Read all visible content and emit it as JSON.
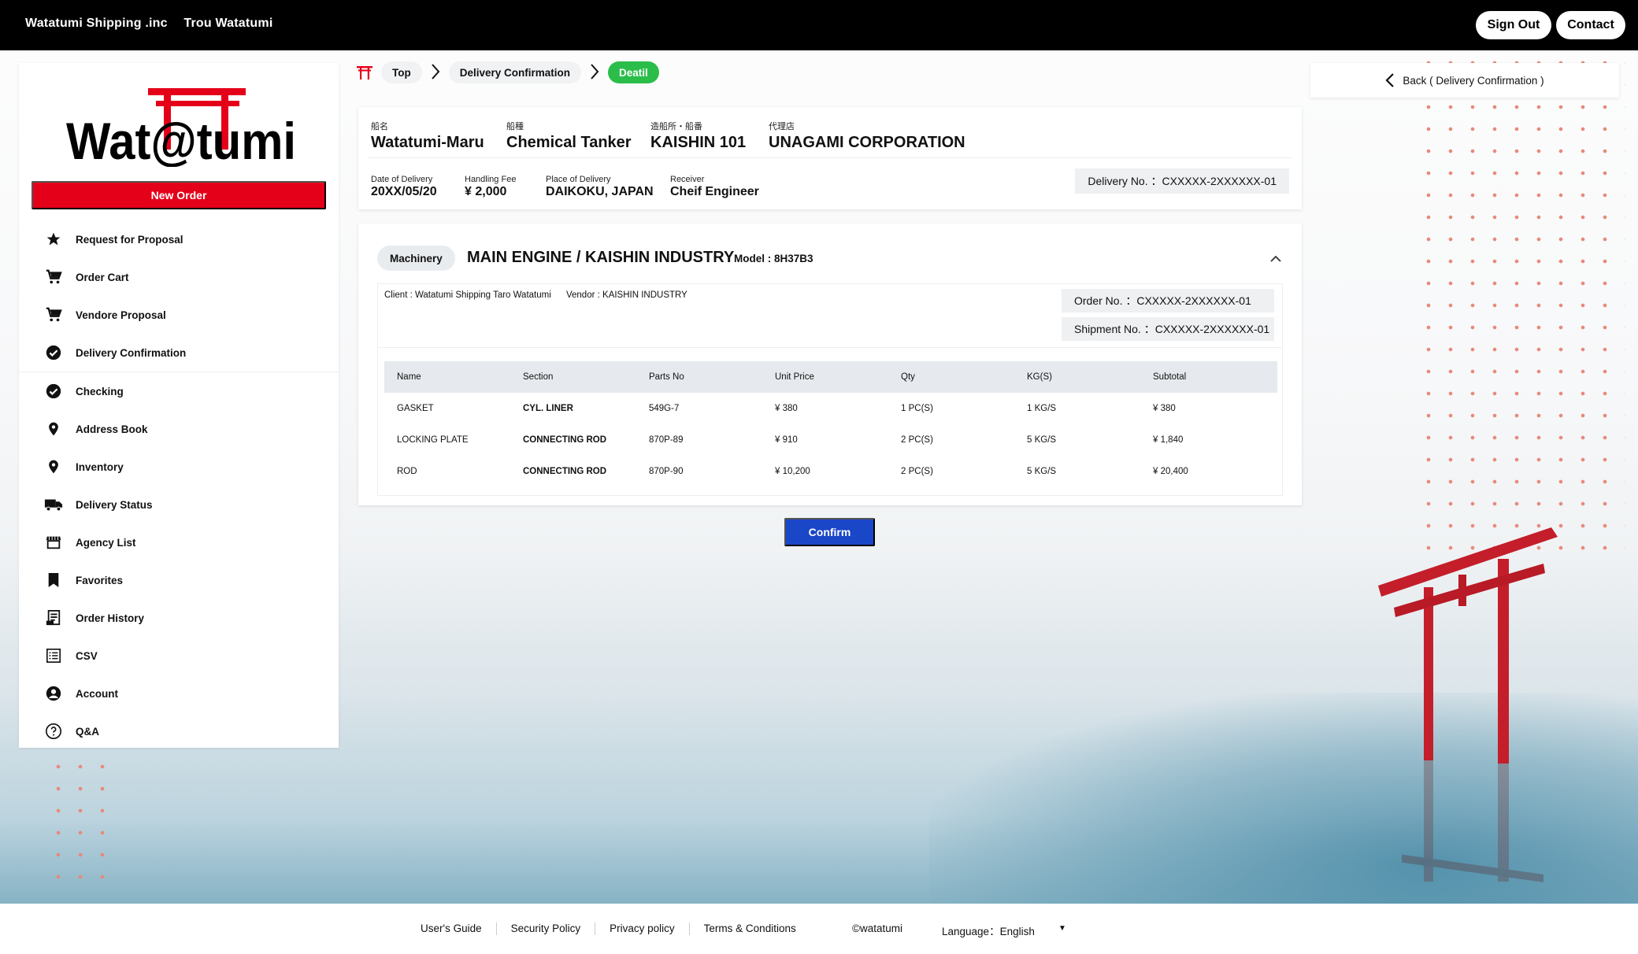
{
  "topbar": {
    "company": "Watatumi Shipping .inc",
    "user": "Trou Watatumi",
    "signout_label": "Sign Out",
    "contact_label": "Contact"
  },
  "logo": {
    "text": "Wat@tumi"
  },
  "sidebar": {
    "new_order_label": "New Order",
    "items": [
      {
        "label": "Request for Proposal",
        "icon": "star-icon"
      },
      {
        "label": "Order Cart",
        "icon": "cart-icon"
      },
      {
        "label": "Vendore Proposal",
        "icon": "cart-icon"
      },
      {
        "label": "Delivery Confirmation",
        "icon": "check-circle-icon"
      },
      {
        "label": "Checking",
        "icon": "check-circle-icon"
      },
      {
        "label": "Address Book",
        "icon": "location-pin-icon"
      },
      {
        "label": "Inventory",
        "icon": "location-pin-icon"
      },
      {
        "label": "Delivery Status",
        "icon": "truck-icon"
      },
      {
        "label": "Agency List",
        "icon": "store-icon"
      },
      {
        "label": "Favorites",
        "icon": "bookmark-icon"
      },
      {
        "label": "Order History",
        "icon": "receipt-icon"
      },
      {
        "label": "CSV",
        "icon": "list-icon"
      },
      {
        "label": "Account",
        "icon": "account-icon"
      },
      {
        "label": "Q&A",
        "icon": "question-icon"
      }
    ]
  },
  "breadcrumb": {
    "top": "Top",
    "delivery_confirmation": "Delivery Confirmation",
    "current": "Deatil"
  },
  "back_button": {
    "label": "Back ( Delivery Confirmation )"
  },
  "ship_info": {
    "ship_name_label": "船名",
    "ship_name": "Watatumi-Maru",
    "ship_type_label": "船種",
    "ship_type": "Chemical Tanker",
    "shipyard_label": "造船所・船番",
    "shipyard": "KAISHIN 101",
    "agency_label": "代理店",
    "agency": "UNAGAMI CORPORATION",
    "date_label": "Date of Delivery",
    "date": "20XX/05/20",
    "fee_label": "Handling Fee",
    "fee": "¥ 2,000",
    "place_label": "Place of Delivery",
    "place": "DAIKOKU, JAPAN",
    "receiver_label": "Receiver",
    "receiver": "Cheif Engineer",
    "delivery_no": "Delivery No. ：CXXXXX-2XXXXXX-01"
  },
  "order": {
    "tag": "Machinery",
    "title": "MAIN ENGINE / KAISHIN INDUSTRY",
    "model": "Model : 8H37B3",
    "client": "Client : Watatumi Shipping Taro Watatumi",
    "vendor": "Vendor : KAISHIN INDUSTRY",
    "order_no": "Order No. ：CXXXXX-2XXXXXX-01",
    "shipment_no": "Shipment No. ：CXXXXX-2XXXXXX-01",
    "columns": [
      "Name",
      "Section",
      "Parts No",
      "Unit Price",
      "Qty",
      "KG(S)",
      "Subtotal"
    ],
    "rows": [
      [
        "GASKET",
        "CYL. LINER",
        "549G-7",
        "¥ 380",
        "1 PC(S)",
        "1 KG/S",
        "¥ 380"
      ],
      [
        "LOCKING PLATE",
        "CONNECTING ROD",
        "870P-89",
        "¥ 910",
        "2 PC(S)",
        "5 KG/S",
        "¥ 1,840"
      ],
      [
        "ROD",
        "CONNECTING ROD",
        "870P-90",
        "¥ 10,200",
        "2 PC(S)",
        "5 KG/S",
        "¥ 20,400"
      ]
    ]
  },
  "confirm_label": "Confirm",
  "footer": {
    "users_guide": "User's Guide",
    "security_policy": "Security Policy",
    "privacy_policy": "Privacy policy",
    "terms": "Terms & Conditions",
    "copyright": "©watatumi",
    "language": "Language：English"
  },
  "colors": {
    "brand_red": "#e5001a",
    "confirm_blue": "#1a46c8",
    "active_green": "#2bbd4a"
  }
}
